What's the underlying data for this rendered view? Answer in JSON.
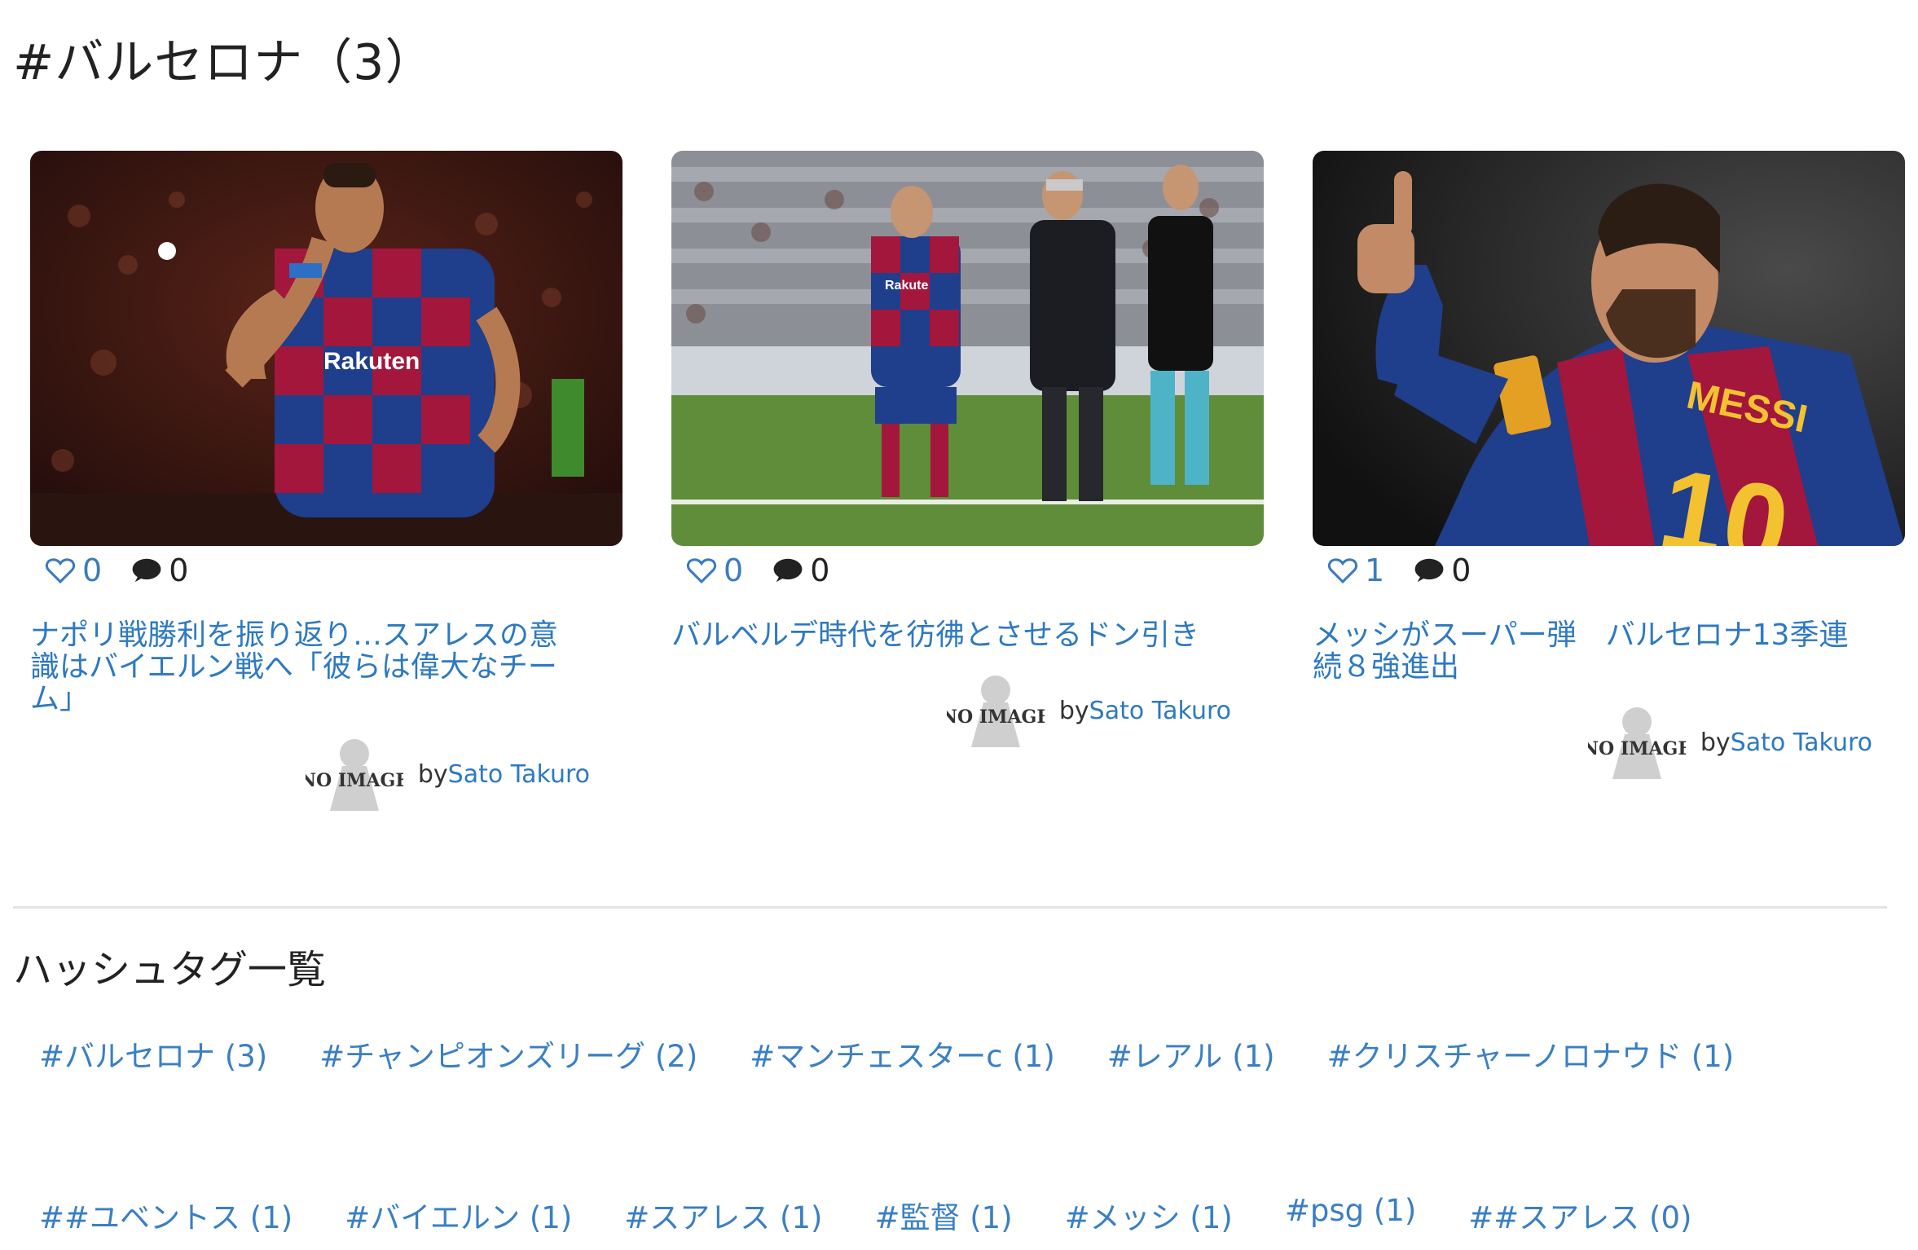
{
  "page": {
    "title": "#バルセロナ（3）"
  },
  "articles": [
    {
      "likes": "0",
      "comments": "0",
      "title": "ナポリ戦勝利を振り返り…スアレスの意識はバイエルン戦へ「彼らは偉大なチーム」",
      "author_prefix": "by",
      "author": "Sato Takuro",
      "avatar_text": "NO IMAGE"
    },
    {
      "likes": "0",
      "comments": "0",
      "title": "バルベルデ時代を彷彿とさせるドン引き",
      "author_prefix": "by",
      "author": "Sato Takuro",
      "avatar_text": "NO IMAGE"
    },
    {
      "likes": "1",
      "comments": "0",
      "title": "メッシがスーパー弾　バルセロナ13季連続８強進出",
      "author_prefix": "by",
      "author": "Sato Takuro",
      "avatar_text": "NO IMAGE"
    }
  ],
  "hashtags": {
    "title": "ハッシュタグ一覧",
    "items": [
      "#バルセロナ (3)",
      "#チャンピオンズリーグ (2)",
      "#マンチェスターc (1)",
      "#レアル (1)",
      "#クリスチャーノロナウド (1)",
      "##ユベントス (1)",
      "#バイエルン (1)",
      "#スアレス (1)",
      "#監督 (1)",
      "#メッシ (1)",
      "#psg (1)",
      "##スアレス (0)"
    ]
  },
  "colors": {
    "link": "#2d79c2",
    "heart": "#3b7bbf",
    "barca_blue": "#1f3e8c",
    "barca_red": "#a3173d"
  }
}
